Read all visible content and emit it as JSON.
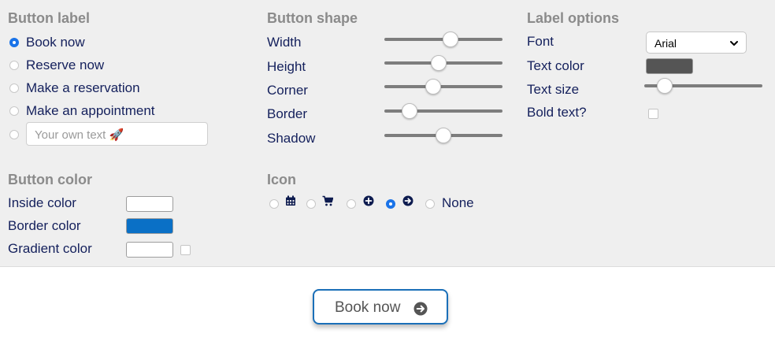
{
  "button_label": {
    "heading": "Button label",
    "options": [
      {
        "label": "Book now",
        "selected": true
      },
      {
        "label": "Reserve now",
        "selected": false
      },
      {
        "label": "Make a reservation",
        "selected": false
      },
      {
        "label": "Make an appointment",
        "selected": false
      }
    ],
    "custom_placeholder": "Your own text 🚀"
  },
  "button_shape": {
    "heading": "Button shape",
    "sliders": [
      {
        "label": "Width",
        "fraction": 0.56
      },
      {
        "label": "Height",
        "fraction": 0.46
      },
      {
        "label": "Corner",
        "fraction": 0.41
      },
      {
        "label": "Border",
        "fraction": 0.21
      },
      {
        "label": "Shadow",
        "fraction": 0.5
      }
    ]
  },
  "label_options": {
    "heading": "Label options",
    "font_label": "Font",
    "font_value": "Arial",
    "text_color_label": "Text color",
    "text_color": "#555555",
    "text_size_label": "Text size",
    "text_size_fraction": 0.17,
    "bold_label": "Bold text?",
    "bold_checked": false
  },
  "button_color": {
    "heading": "Button color",
    "inside_label": "Inside color",
    "inside_color": "#ffffff",
    "border_label": "Border color",
    "border_color": "#0a70c6",
    "gradient_label": "Gradient color",
    "gradient_color": "#ffffff",
    "gradient_enabled": false
  },
  "icon": {
    "heading": "Icon",
    "options": [
      {
        "icon": "calendar-icon",
        "selected": false
      },
      {
        "icon": "cart-icon",
        "selected": false
      },
      {
        "icon": "plus-circle-icon",
        "selected": false
      },
      {
        "icon": "arrow-right-circle-icon",
        "selected": true
      }
    ],
    "none_label": "None"
  },
  "preview": {
    "label": "Book now",
    "icon": "arrow-right-circle-icon"
  }
}
